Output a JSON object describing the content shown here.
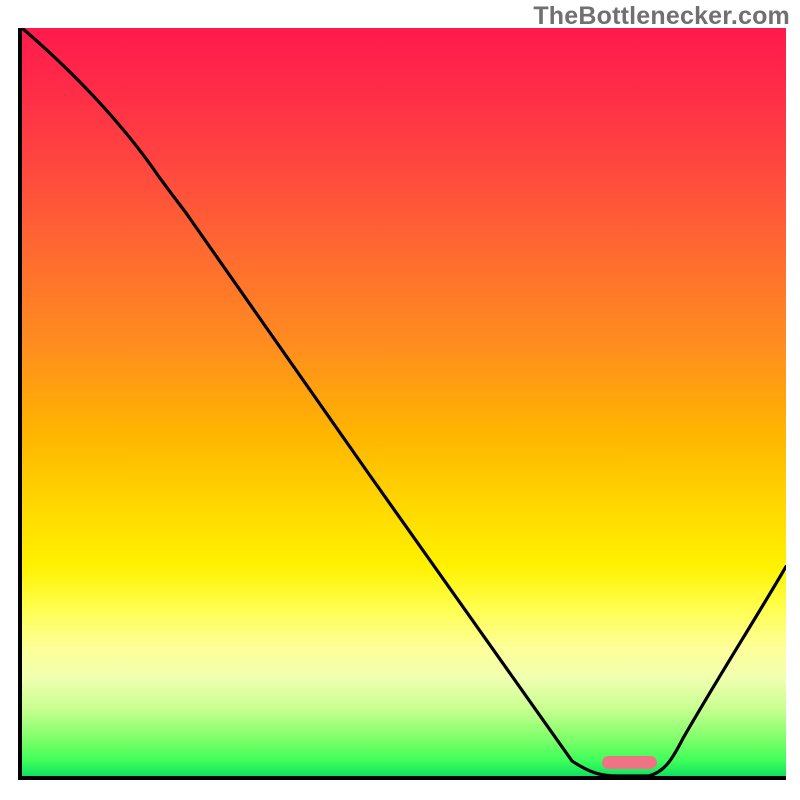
{
  "watermark": "TheBottlenecker.com",
  "chart_data": {
    "type": "line",
    "title": "",
    "xlabel": "",
    "ylabel": "",
    "xlim": [
      0,
      100
    ],
    "ylim": [
      0,
      100
    ],
    "grid": false,
    "legend": false,
    "series": [
      {
        "name": "bottleneck-curve",
        "x": [
          0,
          18,
          22,
          72,
          78,
          82,
          100
        ],
        "y": [
          100,
          80,
          76,
          2,
          0,
          0,
          28
        ]
      }
    ],
    "marker": {
      "name": "recommended-range",
      "x_center": 79,
      "width_pct": 7,
      "y": 1,
      "color": "#ef7384"
    },
    "background": {
      "type": "vertical-gradient",
      "stops": [
        {
          "pct": 0,
          "color": "#ff1a4d"
        },
        {
          "pct": 50,
          "color": "#ffb400"
        },
        {
          "pct": 78,
          "color": "#ffff55"
        },
        {
          "pct": 100,
          "color": "#10e060"
        }
      ]
    }
  }
}
